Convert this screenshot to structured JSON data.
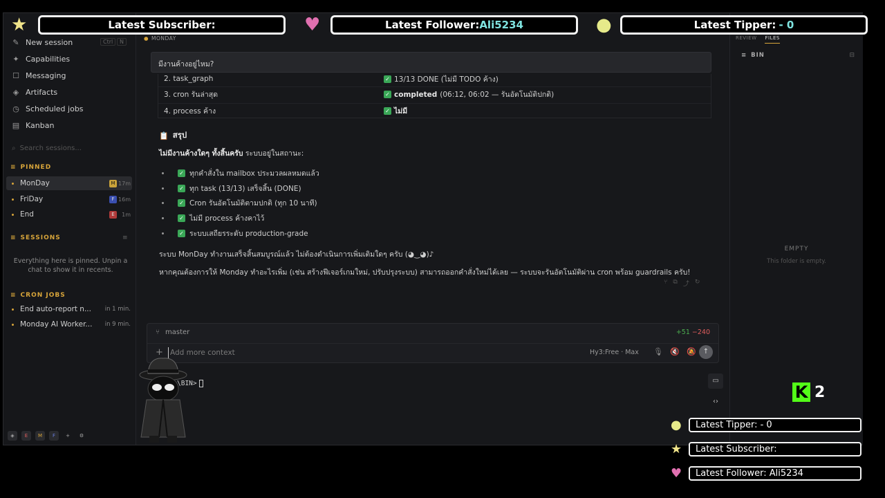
{
  "sidebar": {
    "nav": [
      {
        "label": "New session",
        "icon": "pencil-icon"
      },
      {
        "label": "Capabilities",
        "icon": "sparkle-icon"
      },
      {
        "label": "Messaging",
        "icon": "chat-icon"
      },
      {
        "label": "Artifacts",
        "icon": "artifact-icon"
      },
      {
        "label": "Scheduled jobs",
        "icon": "clock-icon"
      },
      {
        "label": "Kanban",
        "icon": "board-icon"
      }
    ],
    "shortcut_ctrl": "Ctrl",
    "shortcut_key": "N",
    "search_placeholder": "Search sessions...",
    "pinned_title": "PINNED",
    "pinned": [
      {
        "name": "MonDay",
        "badge": "M",
        "badge_color": "#c9a23a",
        "time": "17m"
      },
      {
        "name": "FriDay",
        "badge": "F",
        "badge_color": "#3a4fb0",
        "time": "16m"
      },
      {
        "name": "End",
        "badge": "E",
        "badge_color": "#b03a3a",
        "time": "1m"
      }
    ],
    "sessions_title": "SESSIONS",
    "pinned_note": "Everything here is pinned. Unpin a chat to show it in recents.",
    "cron_title": "CRON JOBS",
    "cron": [
      {
        "name": "End auto-report n...",
        "time": "in 1 min."
      },
      {
        "name": "Monday AI Worker...",
        "time": "in 9 min."
      }
    ],
    "bottom": [
      "E",
      "M",
      "F"
    ]
  },
  "main": {
    "tab": "MONDAY",
    "prompt": "มีงานค้างอยู่ไหม?",
    "table_rows": [
      {
        "c1": "2. task_graph",
        "c2_bold": "",
        "c2": "13/13 DONE (ไม่มี TODO ค้าง)"
      },
      {
        "c1": "3. cron รันล่าสุด",
        "c2_bold": "completed",
        "c2": "(06:12, 06:02 — รันอัตโนมัติปกติ)"
      },
      {
        "c1": "4. process ค้าง",
        "c2_bold": "ไม่มี",
        "c2": ""
      }
    ],
    "summary_title": "สรุป",
    "summary_bold": "ไม่มีงานค้างใดๆ ทั้งสิ้นครับ",
    "summary_rest": " ระบบอยู่ในสถานะ:",
    "bullets": [
      "ทุกคำสั่งใน mailbox ประมวลผลหมดแล้ว",
      "ทุก task (13/13) เสร็จสิ้น (DONE)",
      "Cron รันอัตโนมัติตามปกติ (ทุก 10 นาที)",
      "ไม่มี process ค้างคาไว้",
      "ระบบเสถียรระดับ production-grade"
    ],
    "p2": "ระบบ MonDay ทำงานเสร็จสิ้นสมบูรณ์แล้ว ไม่ต้องดำเนินการเพิ่มเติมใดๆ ครับ (◕‿◕)♪",
    "p3": "หากคุณต้องการให้ Monday ทำอะไรเพิ่ม (เช่น สร้างฟีเจอร์เกมใหม่, ปรับปรุงระบบ) สามารถออกคำสั่งใหม่ได้เลย — ระบบจะรันอัตโนมัติผ่าน cron พร้อม guardrails ครับ!"
  },
  "composer": {
    "branch": "master",
    "additions": "+51",
    "deletions": "−240",
    "placeholder": "Add more context",
    "model": "Hy3:Free · Max"
  },
  "terminal": {
    "prompt": "\\BIN>"
  },
  "right_panel": {
    "tabs": [
      "REVIEW",
      "FILES"
    ],
    "folder": "BIN",
    "empty_title": "EMPTY",
    "empty_sub": "This folder is empty."
  },
  "overlay": {
    "top_subscriber": "Latest Subscriber:",
    "top_follower_label": "Latest Follower: ",
    "top_follower_name": "Ali5234",
    "top_tipper_label": "Latest Tipper: ",
    "top_tipper_value": "- 0",
    "small_tipper": "Latest Tipper:  -  0",
    "small_subscriber": "Latest Subscriber:",
    "small_follower": "Latest Follower: Ali5234",
    "kick_logo": "K",
    "kick_count": "2"
  }
}
